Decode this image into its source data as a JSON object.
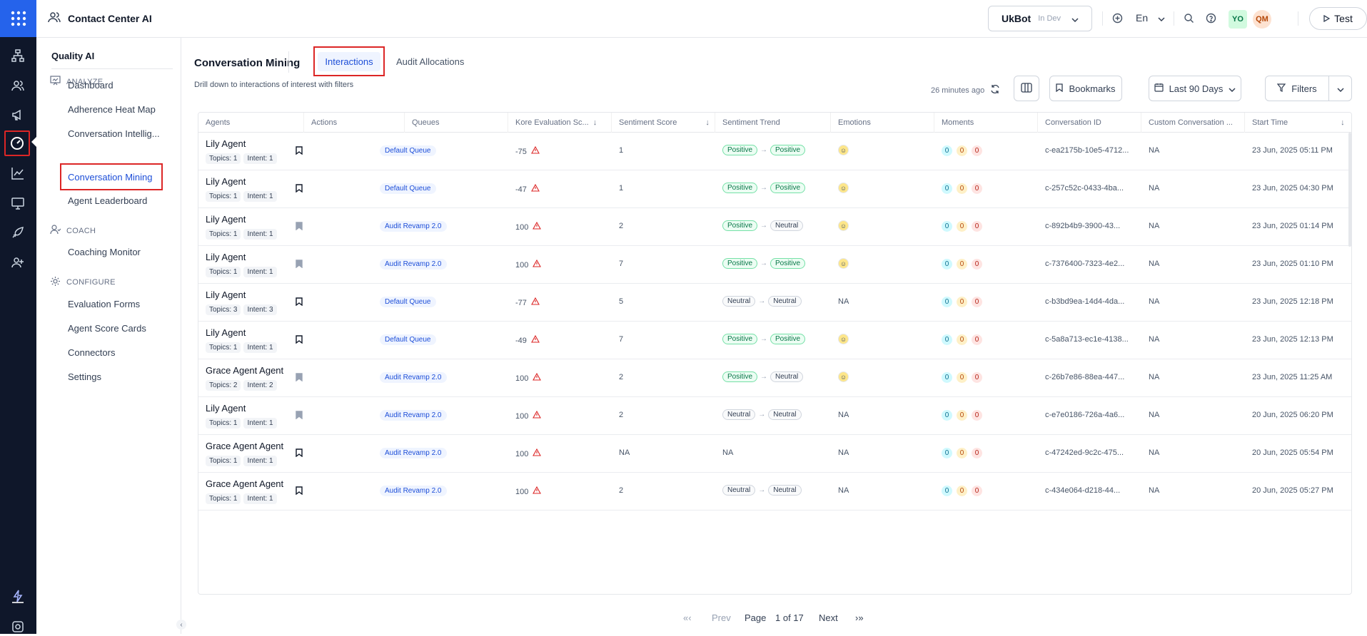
{
  "app": {
    "title": "Contact Center AI"
  },
  "topbar": {
    "bot_name": "UkBot",
    "bot_env": "In Dev",
    "language": "En",
    "avatar1": "YO",
    "avatar2": "QM",
    "test_label": "Test"
  },
  "sidebar": {
    "title": "Quality AI",
    "analyze_label": "ANALYZE",
    "coach_label": "COACH",
    "configure_label": "CONFIGURE",
    "analyze_items": [
      "Dashboard",
      "Adherence Heat Map",
      "Conversation Intellig...",
      "Conversation Mining",
      "Agent Leaderboard"
    ],
    "coach_items": [
      "Coaching Monitor"
    ],
    "configure_items": [
      "Evaluation Forms",
      "Agent Score Cards",
      "Connectors",
      "Settings"
    ]
  },
  "main": {
    "title": "Conversation Mining",
    "tabs": [
      "Interactions",
      "Audit Allocations"
    ],
    "subtitle": "Drill down to interactions of interest with filters",
    "updated": "26 minutes ago",
    "bookmarks_label": "Bookmarks",
    "date_range": "Last 90 Days",
    "filters_label": "Filters"
  },
  "table": {
    "columns": [
      "Agents",
      "Actions",
      "Queues",
      "Kore Evaluation Sc...",
      "Sentiment Score",
      "Sentiment Trend",
      "Emotions",
      "Moments",
      "Conversation ID",
      "Custom Conversation ...",
      "Start Time"
    ],
    "rows": [
      {
        "agent": "Lily Agent",
        "topics": "Topics: 1",
        "intent": "Intent: 1",
        "bookmarked": false,
        "queue": "Default Queue",
        "score": "-75",
        "sentiment": "1",
        "trend_from": "Positive",
        "trend_to": "Positive",
        "emotion": "emoji",
        "m": [
          "0",
          "0",
          "0"
        ],
        "conv_id": "c-ea2175b-10e5-4712...",
        "custom": "NA",
        "start": "23 Jun, 2025 05:11 PM"
      },
      {
        "agent": "Lily Agent",
        "topics": "Topics: 1",
        "intent": "Intent: 1",
        "bookmarked": false,
        "queue": "Default Queue",
        "score": "-47",
        "sentiment": "1",
        "trend_from": "Positive",
        "trend_to": "Positive",
        "emotion": "emoji",
        "m": [
          "0",
          "0",
          "0"
        ],
        "conv_id": "c-257c52c-0433-4ba...",
        "custom": "NA",
        "start": "23 Jun, 2025 04:30 PM"
      },
      {
        "agent": "Lily Agent",
        "topics": "Topics: 1",
        "intent": "Intent: 1",
        "bookmarked": true,
        "queue": "Audit Revamp 2.0",
        "score": "100",
        "sentiment": "2",
        "trend_from": "Positive",
        "trend_to": "Neutral",
        "emotion": "emoji",
        "m": [
          "0",
          "0",
          "0"
        ],
        "conv_id": "c-892b4b9-3900-43...",
        "custom": "NA",
        "start": "23 Jun, 2025 01:14 PM"
      },
      {
        "agent": "Lily Agent",
        "topics": "Topics: 1",
        "intent": "Intent: 1",
        "bookmarked": true,
        "queue": "Audit Revamp 2.0",
        "score": "100",
        "sentiment": "7",
        "trend_from": "Positive",
        "trend_to": "Positive",
        "emotion": "emoji",
        "m": [
          "0",
          "0",
          "0"
        ],
        "conv_id": "c-7376400-7323-4e2...",
        "custom": "NA",
        "start": "23 Jun, 2025 01:10 PM"
      },
      {
        "agent": "Lily Agent",
        "topics": "Topics: 3",
        "intent": "Intent: 3",
        "bookmarked": false,
        "queue": "Default Queue",
        "score": "-77",
        "sentiment": "5",
        "trend_from": "Neutral",
        "trend_to": "Neutral",
        "emotion": "NA",
        "m": [
          "0",
          "0",
          "0"
        ],
        "conv_id": "c-b3bd9ea-14d4-4da...",
        "custom": "NA",
        "start": "23 Jun, 2025 12:18 PM"
      },
      {
        "agent": "Lily Agent",
        "topics": "Topics: 1",
        "intent": "Intent: 1",
        "bookmarked": false,
        "queue": "Default Queue",
        "score": "-49",
        "sentiment": "7",
        "trend_from": "Positive",
        "trend_to": "Positive",
        "emotion": "emoji",
        "m": [
          "0",
          "0",
          "0"
        ],
        "conv_id": "c-5a8a713-ec1e-4138...",
        "custom": "NA",
        "start": "23 Jun, 2025 12:13 PM"
      },
      {
        "agent": "Grace Agent Agent",
        "topics": "Topics: 2",
        "intent": "Intent: 2",
        "bookmarked": true,
        "queue": "Audit Revamp 2.0",
        "score": "100",
        "sentiment": "2",
        "trend_from": "Positive",
        "trend_to": "Neutral",
        "emotion": "emoji",
        "m": [
          "0",
          "0",
          "0"
        ],
        "conv_id": "c-26b7e86-88ea-447...",
        "custom": "NA",
        "start": "23 Jun, 2025 11:25 AM"
      },
      {
        "agent": "Lily Agent",
        "topics": "Topics: 1",
        "intent": "Intent: 1",
        "bookmarked": true,
        "queue": "Audit Revamp 2.0",
        "score": "100",
        "sentiment": "2",
        "trend_from": "Neutral",
        "trend_to": "Neutral",
        "emotion": "NA",
        "m": [
          "0",
          "0",
          "0"
        ],
        "conv_id": "c-e7e0186-726a-4a6...",
        "custom": "NA",
        "start": "20 Jun, 2025 06:20 PM"
      },
      {
        "agent": "Grace Agent Agent",
        "topics": "Topics: 1",
        "intent": "Intent: 1",
        "bookmarked": false,
        "queue": "Audit Revamp 2.0",
        "score": "100",
        "sentiment": "NA",
        "trend_from": "NA",
        "trend_to": "",
        "emotion": "NA",
        "m": [
          "0",
          "0",
          "0"
        ],
        "conv_id": "c-47242ed-9c2c-475...",
        "custom": "NA",
        "start": "20 Jun, 2025 05:54 PM"
      },
      {
        "agent": "Grace Agent Agent",
        "topics": "Topics: 1",
        "intent": "Intent: 1",
        "bookmarked": false,
        "queue": "Audit Revamp 2.0",
        "score": "100",
        "sentiment": "2",
        "trend_from": "Neutral",
        "trend_to": "Neutral",
        "emotion": "NA",
        "m": [
          "0",
          "0",
          "0"
        ],
        "conv_id": "c-434e064-d218-44...",
        "custom": "NA",
        "start": "20 Jun, 2025 05:27 PM"
      }
    ]
  },
  "pager": {
    "first": "«‹",
    "prev": "Prev",
    "page_label": "Page",
    "page_info": "1 of 17",
    "next": "Next",
    "last": "›»"
  }
}
